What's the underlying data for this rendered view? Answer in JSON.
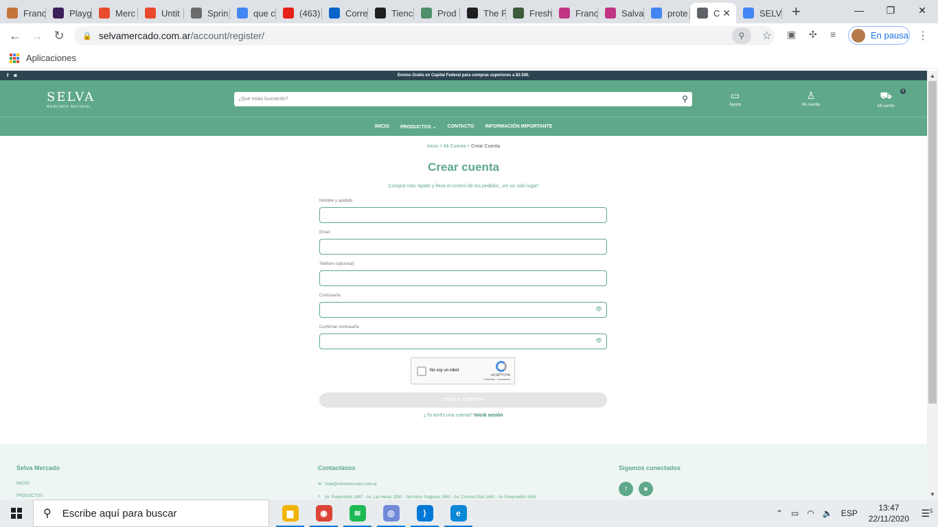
{
  "browser": {
    "tabs": [
      {
        "label": "Franc",
        "icon": "notes-icon",
        "color": "#c4733b"
      },
      {
        "label": "Playg",
        "icon": "playground-icon",
        "color": "#3b1f5b"
      },
      {
        "label": "Merc",
        "icon": "figma-icon",
        "color": "#e84b2c"
      },
      {
        "label": "Untit",
        "icon": "figma-icon",
        "color": "#e84b2c"
      },
      {
        "label": "Sprin",
        "icon": "timer-icon",
        "color": "#6b6b6b"
      },
      {
        "label": "que c",
        "icon": "google-icon",
        "color": "#4285f4"
      },
      {
        "label": "(463)",
        "icon": "youtube-icon",
        "color": "#e62117"
      },
      {
        "label": "Corre",
        "icon": "outlook-icon",
        "color": "#0a64c9"
      },
      {
        "label": "Tienc",
        "icon": "tiendanube-icon",
        "color": "#1f1f1f"
      },
      {
        "label": "Prod",
        "icon": "product-icon",
        "color": "#4f8f6a"
      },
      {
        "label": "The F",
        "icon": "thefork-icon",
        "color": "#1f1f1f"
      },
      {
        "label": "Fresh",
        "icon": "leaf-icon",
        "color": "#3b5b3b"
      },
      {
        "label": "Franc",
        "icon": "instagram-icon",
        "color": "#c13584"
      },
      {
        "label": "Salva",
        "icon": "instagram-icon",
        "color": "#c13584"
      },
      {
        "label": "prote",
        "icon": "google-icon",
        "color": "#4285f4"
      },
      {
        "label": "C",
        "icon": "globe-icon",
        "color": "#5f6368",
        "active": true
      },
      {
        "label": "SELV",
        "icon": "google-icon",
        "color": "#4285f4"
      }
    ],
    "url_host": "selvamercado.com.ar",
    "url_path": "/account/register/",
    "profile_label": "En pausa",
    "bookmarks_label": "Aplicaciones"
  },
  "site": {
    "top_banner": "Envíos Gratis en Capital Federal para compras superiores a $2.500.",
    "logo_main": "SELVA",
    "logo_sub": "MERCADO NATURAL",
    "search_placeholder": "¿Qué estás buscando?",
    "header_links": {
      "help": "Ayuda",
      "account": "Mi cuenta",
      "cart": "Mi carrito"
    },
    "cart_count": "0",
    "nav": [
      "INICIO",
      "PRODUCTOS",
      "CONTACTO",
      "INFORMACIÓN IMPORTANTE"
    ],
    "breadcrumb": {
      "home": "Inicio",
      "account": "Mi Cuenta",
      "current": "Crear Cuenta",
      "sep": ">"
    },
    "title": "Crear cuenta",
    "subtitle": "Comprá más rápido y llevá el control de tus pedidos, ¡en un solo lugar!",
    "fields": [
      {
        "label": "Nombre y apellido",
        "password": false
      },
      {
        "label": "Email",
        "password": false
      },
      {
        "label": "Teléfono (opcional)",
        "password": false
      },
      {
        "label": "Contraseña",
        "password": true
      },
      {
        "label": "Confirmar contraseña",
        "password": true
      }
    ],
    "captcha": {
      "label": "No soy un robot",
      "brand": "reCAPTCHA",
      "terms": "Privacidad - Condiciones"
    },
    "submit_label": "CREAR CUENTA",
    "login_prompt": "¿Ya tenés una cuenta?",
    "login_link": "Iniciá sesión",
    "footer": {
      "col1_title": "Selva Mercado",
      "col1_items": [
        "INICIO",
        "PRODUCTOS"
      ],
      "col2_title": "Contactános",
      "email": "hola@selvamercado.com.ar",
      "address": "Av. Pueyrredón 1887 - Av. Las Heras 2930 - Jerónimo Salguero 2662 - Av. Coronel Díaz 1661 - Av Pueyrredón 1454",
      "col3_title": "Sigamos conectados"
    },
    "colors": {
      "brand_green": "#5fa88a",
      "dark_strip": "#2c4651"
    }
  },
  "taskbar": {
    "search_placeholder": "Escribe aquí para buscar",
    "apps": [
      {
        "name": "file-explorer-icon",
        "color": "#f0b400",
        "glyph": "▆"
      },
      {
        "name": "chrome-icon",
        "color": "#db4437",
        "glyph": "◉"
      },
      {
        "name": "spotify-icon",
        "color": "#1db954",
        "glyph": "≋"
      },
      {
        "name": "discord-icon",
        "color": "#7289da",
        "glyph": "◎"
      },
      {
        "name": "vscode-icon",
        "color": "#0078d7",
        "glyph": "⟩"
      },
      {
        "name": "edge-icon",
        "color": "#0c88d8",
        "glyph": "e"
      }
    ],
    "language": "ESP",
    "time": "13:47",
    "date": "22/11/2020",
    "notifications": "5"
  }
}
